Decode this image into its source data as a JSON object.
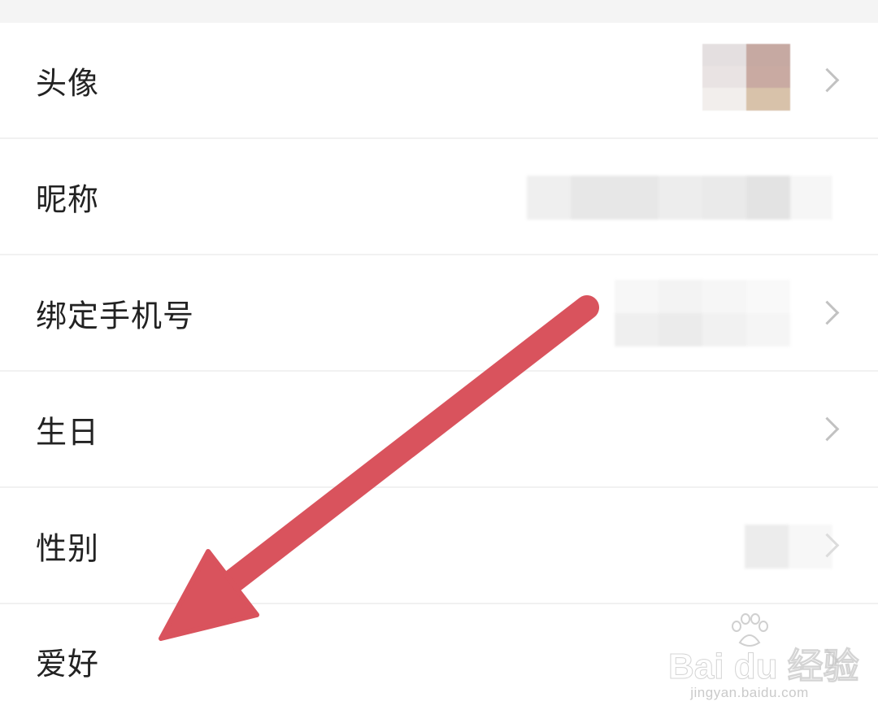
{
  "settings": {
    "rows": [
      {
        "label": "头像"
      },
      {
        "label": "昵称"
      },
      {
        "label": "绑定手机号"
      },
      {
        "label": "生日"
      },
      {
        "label": "性别"
      },
      {
        "label": "爱好"
      }
    ]
  },
  "icons": {
    "chevron": "chevron-right-icon",
    "arrow": "arrow-annotation-icon",
    "watermark_paw": "paw-icon"
  },
  "colors": {
    "arrow": "#d9535d",
    "label": "#222222",
    "chevron": "#c2c2c2",
    "divider": "#f1f1f1",
    "background": "#f4f4f4"
  },
  "watermark": {
    "logo": "Bai du 经验",
    "url": "jingyan.baidu.com"
  }
}
